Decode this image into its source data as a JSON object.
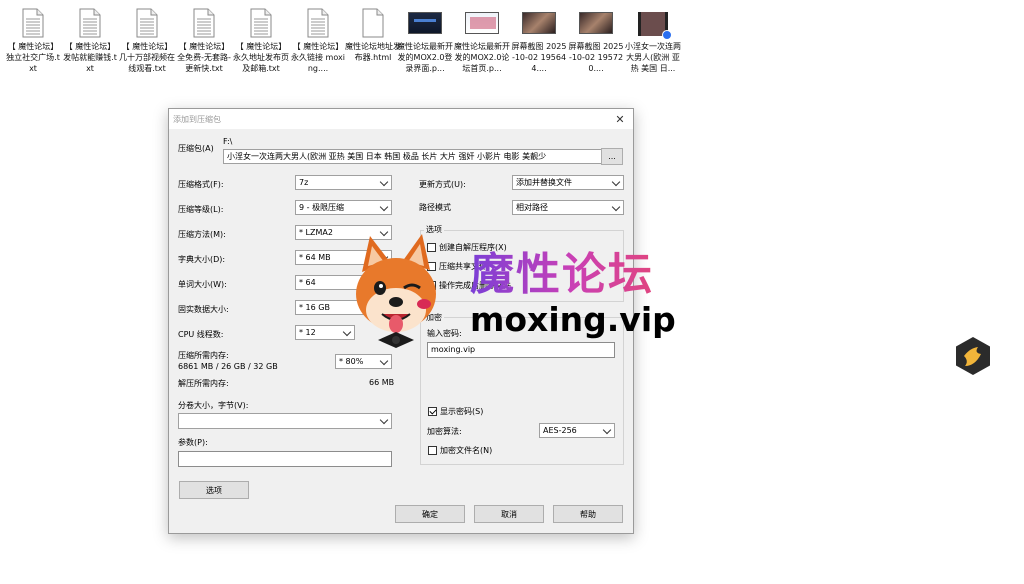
{
  "desktop": {
    "files": [
      {
        "type": "doc",
        "label": "【 魔性论坛】独立社交广场.txt"
      },
      {
        "type": "doc",
        "label": "【 魔性论坛】发帖就能赚钱.txt"
      },
      {
        "type": "doc",
        "label": "【 魔性论坛】几十万部视频在线观看.txt"
      },
      {
        "type": "doc",
        "label": "【 魔性论坛】全免费-无套路-更新快.txt"
      },
      {
        "type": "doc",
        "label": "【 魔性论坛】永久地址发布页及邮箱.txt"
      },
      {
        "type": "doc",
        "label": "【 魔性论坛】永久链接 moxing...."
      },
      {
        "type": "blank",
        "label": "魔性论坛地址发布器.html"
      },
      {
        "type": "dark",
        "label": "魔性论坛最新开发的MOX2.0登录界面.p..."
      },
      {
        "type": "light",
        "label": "魔性论坛最新开发的MOX2.0论坛首页.p..."
      },
      {
        "type": "photo",
        "label": "屏幕截图 2025-10-02 195644...."
      },
      {
        "type": "photo",
        "label": "屏幕截图 2025-10-02 195720...."
      },
      {
        "type": "video",
        "label": "小淫女一次连两大男人(欧洲 亚热 美国 日..."
      }
    ]
  },
  "dialog": {
    "title": "添加到压缩包",
    "archive_label": "压缩包(A)",
    "archive_path": "F:\\",
    "archive_name": "小淫女一次连两大男人(欧洲 亚热 美国 日本 韩国 极品 长片 大片 强奸 小影片 电影 美靓少",
    "browse_button": "...",
    "left": {
      "format_label": "压缩格式(F):",
      "format_value": "7z",
      "level_label": "压缩等级(L):",
      "level_value": "9 - 极限压缩",
      "method_label": "压缩方法(M):",
      "method_value": "* LZMA2",
      "dict_label": "字典大小(D):",
      "dict_value": "* 64 MB",
      "word_label": "单词大小(W):",
      "word_value": "* 64",
      "solid_label": "固实数据大小:",
      "solid_value": "* 16 GB",
      "cpu_label": "CPU 线程数:",
      "cpu_value": "* 12",
      "mem_label": "压缩所需内存:",
      "mem_detail": "6861 MB / 26 GB / 32 GB",
      "mem_value": "* 80%",
      "decomp_label": "解压所需内存:",
      "decomp_value": "66 MB",
      "split_label": "分卷大小，字节(V):",
      "split_value": "",
      "params_label": "参数(P):",
      "params_value": "",
      "options_button": "选项"
    },
    "right": {
      "update_label": "更新方式(U):",
      "update_value": "添加并替换文件",
      "path_label": "路径模式",
      "path_value": "相对路径",
      "options_group": "选项",
      "opt_sfx": "创建自解压程序(X)",
      "opt_shared": "压缩共享文件",
      "opt_delete": "操作完成后删除文件",
      "encrypt_group": "加密",
      "password_label": "输入密码:",
      "password_value": "moxing.vip",
      "show_password": "显示密码(S)",
      "show_password_checked": true,
      "encrypt_method_label": "加密算法:",
      "encrypt_method_value": "AES-256",
      "encrypt_names": "加密文件名(N)",
      "encrypt_names_checked": false
    },
    "buttons": {
      "ok": "确定",
      "cancel": "取消",
      "help": "帮助"
    }
  },
  "watermark": {
    "title": "魔性论坛",
    "domain": "moxing.vip",
    "colors": {
      "start": "#7b3fd6",
      "end": "#e0457f"
    }
  }
}
